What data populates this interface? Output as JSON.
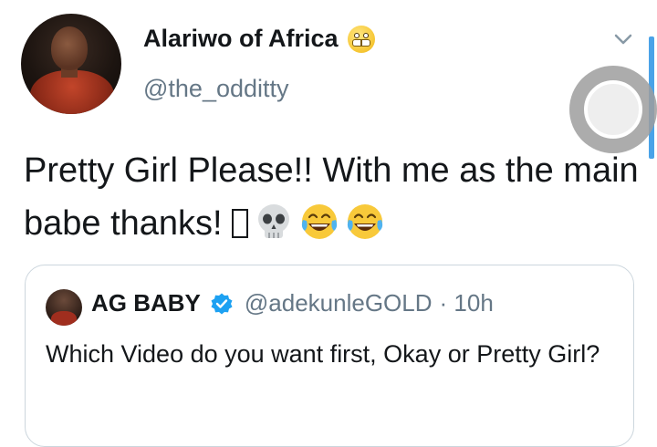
{
  "tweet": {
    "author_name": "Alariwo of Africa",
    "author_handle": "@the_odditty",
    "text": "Pretty Girl Please!! With me as the main babe thanks!",
    "emojis": [
      "missing-glyph",
      "skull",
      "tears-of-joy",
      "tears-of-joy"
    ]
  },
  "quoted_tweet": {
    "author_name": "AG BABY",
    "author_handle": "@adekunleGOLD",
    "time": "· 10h",
    "text": "Which Video do you want first, Okay or Pretty Girl?"
  },
  "colors": {
    "secondary_text": "#657786",
    "verified_blue": "#1da1f2",
    "scrollbar": "#4aa3e8"
  },
  "icons": [
    "grimacing-face-emoji",
    "chevron-down-icon",
    "verified-badge-icon",
    "skull-emoji",
    "tears-of-joy-emoji"
  ]
}
